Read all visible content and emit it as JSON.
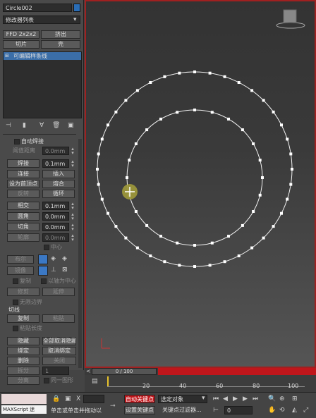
{
  "object_name": "Circle002",
  "modifier_list": "修改器列表",
  "buttons_top": {
    "ffd": "FFD 2x2x2",
    "extrude": "挤出",
    "slice": "切片",
    "shell": "壳"
  },
  "stack_item": "可编辑样条线",
  "panel": {
    "auto_weld": "自动焊接",
    "threshold_label": "阈值距离",
    "threshold_value": "0.0mm",
    "weld": "焊接",
    "weld_value": "0.1mm",
    "connect": "连接",
    "insert": "插入",
    "make_first": "设为首顶点",
    "fuse": "熔合",
    "reverse": "反转",
    "cycle": "循环",
    "cross_insert": "相交",
    "cross_value": "0.1mm",
    "fillet": "圆角",
    "fillet_value": "0.0mm",
    "chamfer": "切角",
    "chamfer_value": "0.0mm",
    "outline": "轮廓",
    "outline_value": "0.0mm",
    "center": "中心",
    "boolean": "布尔",
    "mirror": "镜像",
    "copy_chk": "复制",
    "about_pivot": "以轴为中心",
    "trim": "修剪",
    "extend": "延伸",
    "infinite_bounds": "无限边界",
    "tangent": "切线",
    "copy": "复制",
    "paste": "粘贴",
    "paste_length": "粘贴长度",
    "hide": "隐藏",
    "unhide_all": "全部取消隐藏",
    "bind": "绑定",
    "unbind": "取消绑定",
    "delete": "删除",
    "close": "关闭",
    "divide": "拆分",
    "divide_value": "1",
    "detach": "分离",
    "same_shape": "同一图形"
  },
  "timeline": {
    "frame": "0 / 100",
    "ticks": [
      "20",
      "40",
      "60",
      "80",
      "100"
    ]
  },
  "status": {
    "maxscript": "MAXScript 迷",
    "prompt": "单击或单击并拖动以",
    "auto_key": "自动关键点",
    "set_key": "设置关键点",
    "selected": "选定对象",
    "key_filters": "关键点过滤器...",
    "frame_field": "0"
  }
}
